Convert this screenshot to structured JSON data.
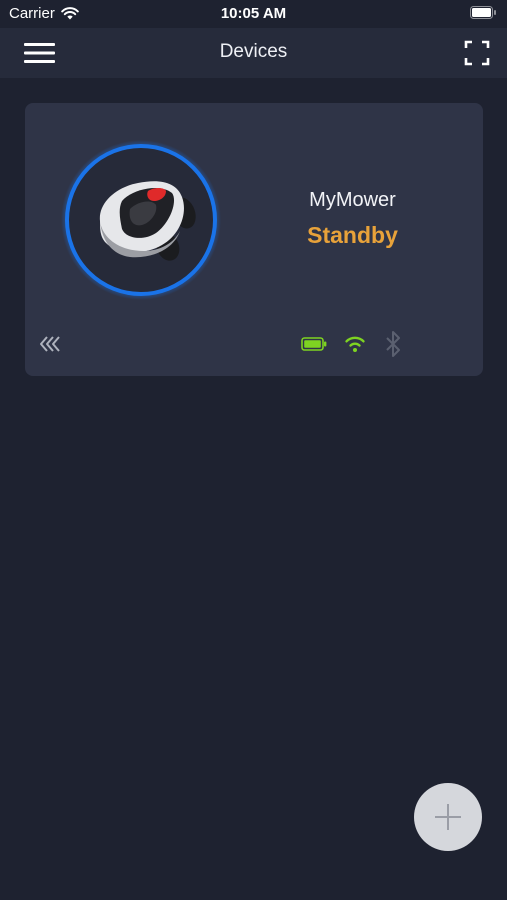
{
  "status_bar": {
    "carrier": "Carrier",
    "time": "10:05 AM",
    "icons": [
      "wifi-icon",
      "battery-icon"
    ]
  },
  "nav": {
    "title": "Devices",
    "left_icon": "hamburger-menu-icon",
    "right_icon": "fullscreen-icon"
  },
  "device": {
    "name": "MyMower",
    "status": "Standby",
    "status_color": "#e8a23a",
    "ring_color": "#1a73e8",
    "indicators": {
      "battery": "battery-icon",
      "battery_color": "#7ed321",
      "wifi": "wifi-icon",
      "wifi_color": "#7ed321",
      "bluetooth": "bluetooth-icon",
      "bluetooth_color": "#5b6070"
    }
  },
  "fab": {
    "icon": "plus-icon"
  },
  "colors": {
    "background": "#1e2230",
    "nav_bar": "#262b3b",
    "card": "#2f3447"
  }
}
